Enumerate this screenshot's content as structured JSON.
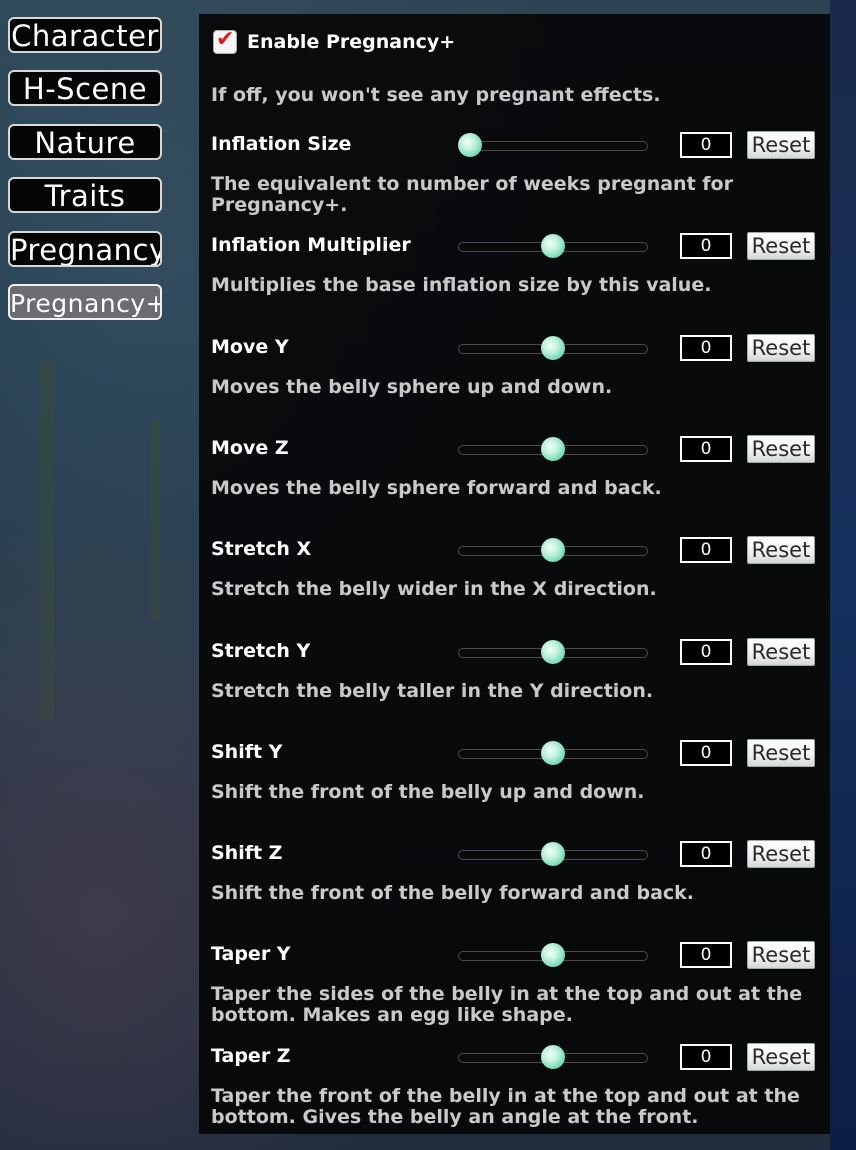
{
  "tabs": [
    {
      "label": "Character",
      "active": false
    },
    {
      "label": "H-Scene",
      "active": false
    },
    {
      "label": "Nature",
      "active": false
    },
    {
      "label": "Traits",
      "active": false
    },
    {
      "label": "Pregnancy",
      "active": false
    },
    {
      "label": "Pregnancy+",
      "active": true
    }
  ],
  "enable": {
    "label": "Enable Pregnancy+",
    "checked": true,
    "description": "If off, you won't see any pregnant effects."
  },
  "settings": [
    {
      "label": "Inflation Size",
      "value": "0",
      "slider_fraction": 0.06,
      "reset_label": "Reset",
      "description": "The equivalent to number of weeks pregnant for Pregnancy+."
    },
    {
      "label": "Inflation Multiplier",
      "value": "0",
      "slider_fraction": 0.5,
      "reset_label": "Reset",
      "description": "Multiplies the base inflation size by this value."
    },
    {
      "label": "Move Y",
      "value": "0",
      "slider_fraction": 0.5,
      "reset_label": "Reset",
      "description": "Moves the belly sphere up and down."
    },
    {
      "label": "Move Z",
      "value": "0",
      "slider_fraction": 0.5,
      "reset_label": "Reset",
      "description": "Moves the belly sphere forward and back."
    },
    {
      "label": "Stretch X",
      "value": "0",
      "slider_fraction": 0.5,
      "reset_label": "Reset",
      "description": "Stretch the belly wider in the X direction."
    },
    {
      "label": "Stretch Y",
      "value": "0",
      "slider_fraction": 0.5,
      "reset_label": "Reset",
      "description": "Stretch the belly taller in the Y direction."
    },
    {
      "label": "Shift Y",
      "value": "0",
      "slider_fraction": 0.5,
      "reset_label": "Reset",
      "description": "Shift the front of the belly up and down."
    },
    {
      "label": "Shift Z",
      "value": "0",
      "slider_fraction": 0.5,
      "reset_label": "Reset",
      "description": "Shift the front of the belly forward and back."
    },
    {
      "label": "Taper Y",
      "value": "0",
      "slider_fraction": 0.5,
      "reset_label": "Reset",
      "description": "Taper the sides of the belly in at the top and out at the bottom.  Makes an egg like shape."
    },
    {
      "label": "Taper Z",
      "value": "0",
      "slider_fraction": 0.5,
      "reset_label": "Reset",
      "description": "Taper the front of the belly in at the top and out at the bottom.  Gives the belly an angle at the front."
    }
  ],
  "colors": {
    "panel_bg": "#060608",
    "slider_thumb": "#5fd3a8",
    "checkmark": "#d81f1f"
  }
}
